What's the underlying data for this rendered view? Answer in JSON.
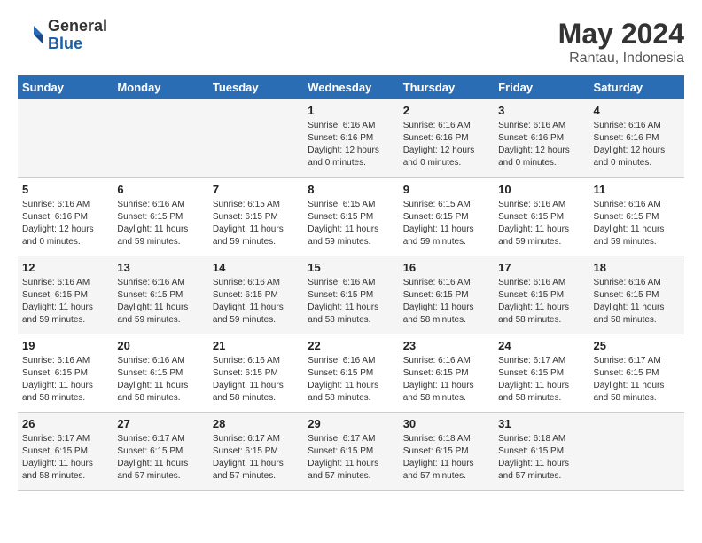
{
  "header": {
    "logo_general": "General",
    "logo_blue": "Blue",
    "month_year": "May 2024",
    "location": "Rantau, Indonesia"
  },
  "days_of_week": [
    "Sunday",
    "Monday",
    "Tuesday",
    "Wednesday",
    "Thursday",
    "Friday",
    "Saturday"
  ],
  "weeks": [
    [
      {
        "day": "",
        "sunrise": "",
        "sunset": "",
        "daylight": ""
      },
      {
        "day": "",
        "sunrise": "",
        "sunset": "",
        "daylight": ""
      },
      {
        "day": "",
        "sunrise": "",
        "sunset": "",
        "daylight": ""
      },
      {
        "day": "1",
        "sunrise": "Sunrise: 6:16 AM",
        "sunset": "Sunset: 6:16 PM",
        "daylight": "Daylight: 12 hours and 0 minutes."
      },
      {
        "day": "2",
        "sunrise": "Sunrise: 6:16 AM",
        "sunset": "Sunset: 6:16 PM",
        "daylight": "Daylight: 12 hours and 0 minutes."
      },
      {
        "day": "3",
        "sunrise": "Sunrise: 6:16 AM",
        "sunset": "Sunset: 6:16 PM",
        "daylight": "Daylight: 12 hours and 0 minutes."
      },
      {
        "day": "4",
        "sunrise": "Sunrise: 6:16 AM",
        "sunset": "Sunset: 6:16 PM",
        "daylight": "Daylight: 12 hours and 0 minutes."
      }
    ],
    [
      {
        "day": "5",
        "sunrise": "Sunrise: 6:16 AM",
        "sunset": "Sunset: 6:16 PM",
        "daylight": "Daylight: 12 hours and 0 minutes."
      },
      {
        "day": "6",
        "sunrise": "Sunrise: 6:16 AM",
        "sunset": "Sunset: 6:15 PM",
        "daylight": "Daylight: 11 hours and 59 minutes."
      },
      {
        "day": "7",
        "sunrise": "Sunrise: 6:15 AM",
        "sunset": "Sunset: 6:15 PM",
        "daylight": "Daylight: 11 hours and 59 minutes."
      },
      {
        "day": "8",
        "sunrise": "Sunrise: 6:15 AM",
        "sunset": "Sunset: 6:15 PM",
        "daylight": "Daylight: 11 hours and 59 minutes."
      },
      {
        "day": "9",
        "sunrise": "Sunrise: 6:15 AM",
        "sunset": "Sunset: 6:15 PM",
        "daylight": "Daylight: 11 hours and 59 minutes."
      },
      {
        "day": "10",
        "sunrise": "Sunrise: 6:16 AM",
        "sunset": "Sunset: 6:15 PM",
        "daylight": "Daylight: 11 hours and 59 minutes."
      },
      {
        "day": "11",
        "sunrise": "Sunrise: 6:16 AM",
        "sunset": "Sunset: 6:15 PM",
        "daylight": "Daylight: 11 hours and 59 minutes."
      }
    ],
    [
      {
        "day": "12",
        "sunrise": "Sunrise: 6:16 AM",
        "sunset": "Sunset: 6:15 PM",
        "daylight": "Daylight: 11 hours and 59 minutes."
      },
      {
        "day": "13",
        "sunrise": "Sunrise: 6:16 AM",
        "sunset": "Sunset: 6:15 PM",
        "daylight": "Daylight: 11 hours and 59 minutes."
      },
      {
        "day": "14",
        "sunrise": "Sunrise: 6:16 AM",
        "sunset": "Sunset: 6:15 PM",
        "daylight": "Daylight: 11 hours and 59 minutes."
      },
      {
        "day": "15",
        "sunrise": "Sunrise: 6:16 AM",
        "sunset": "Sunset: 6:15 PM",
        "daylight": "Daylight: 11 hours and 58 minutes."
      },
      {
        "day": "16",
        "sunrise": "Sunrise: 6:16 AM",
        "sunset": "Sunset: 6:15 PM",
        "daylight": "Daylight: 11 hours and 58 minutes."
      },
      {
        "day": "17",
        "sunrise": "Sunrise: 6:16 AM",
        "sunset": "Sunset: 6:15 PM",
        "daylight": "Daylight: 11 hours and 58 minutes."
      },
      {
        "day": "18",
        "sunrise": "Sunrise: 6:16 AM",
        "sunset": "Sunset: 6:15 PM",
        "daylight": "Daylight: 11 hours and 58 minutes."
      }
    ],
    [
      {
        "day": "19",
        "sunrise": "Sunrise: 6:16 AM",
        "sunset": "Sunset: 6:15 PM",
        "daylight": "Daylight: 11 hours and 58 minutes."
      },
      {
        "day": "20",
        "sunrise": "Sunrise: 6:16 AM",
        "sunset": "Sunset: 6:15 PM",
        "daylight": "Daylight: 11 hours and 58 minutes."
      },
      {
        "day": "21",
        "sunrise": "Sunrise: 6:16 AM",
        "sunset": "Sunset: 6:15 PM",
        "daylight": "Daylight: 11 hours and 58 minutes."
      },
      {
        "day": "22",
        "sunrise": "Sunrise: 6:16 AM",
        "sunset": "Sunset: 6:15 PM",
        "daylight": "Daylight: 11 hours and 58 minutes."
      },
      {
        "day": "23",
        "sunrise": "Sunrise: 6:16 AM",
        "sunset": "Sunset: 6:15 PM",
        "daylight": "Daylight: 11 hours and 58 minutes."
      },
      {
        "day": "24",
        "sunrise": "Sunrise: 6:17 AM",
        "sunset": "Sunset: 6:15 PM",
        "daylight": "Daylight: 11 hours and 58 minutes."
      },
      {
        "day": "25",
        "sunrise": "Sunrise: 6:17 AM",
        "sunset": "Sunset: 6:15 PM",
        "daylight": "Daylight: 11 hours and 58 minutes."
      }
    ],
    [
      {
        "day": "26",
        "sunrise": "Sunrise: 6:17 AM",
        "sunset": "Sunset: 6:15 PM",
        "daylight": "Daylight: 11 hours and 58 minutes."
      },
      {
        "day": "27",
        "sunrise": "Sunrise: 6:17 AM",
        "sunset": "Sunset: 6:15 PM",
        "daylight": "Daylight: 11 hours and 57 minutes."
      },
      {
        "day": "28",
        "sunrise": "Sunrise: 6:17 AM",
        "sunset": "Sunset: 6:15 PM",
        "daylight": "Daylight: 11 hours and 57 minutes."
      },
      {
        "day": "29",
        "sunrise": "Sunrise: 6:17 AM",
        "sunset": "Sunset: 6:15 PM",
        "daylight": "Daylight: 11 hours and 57 minutes."
      },
      {
        "day": "30",
        "sunrise": "Sunrise: 6:18 AM",
        "sunset": "Sunset: 6:15 PM",
        "daylight": "Daylight: 11 hours and 57 minutes."
      },
      {
        "day": "31",
        "sunrise": "Sunrise: 6:18 AM",
        "sunset": "Sunset: 6:15 PM",
        "daylight": "Daylight: 11 hours and 57 minutes."
      },
      {
        "day": "",
        "sunrise": "",
        "sunset": "",
        "daylight": ""
      }
    ]
  ]
}
